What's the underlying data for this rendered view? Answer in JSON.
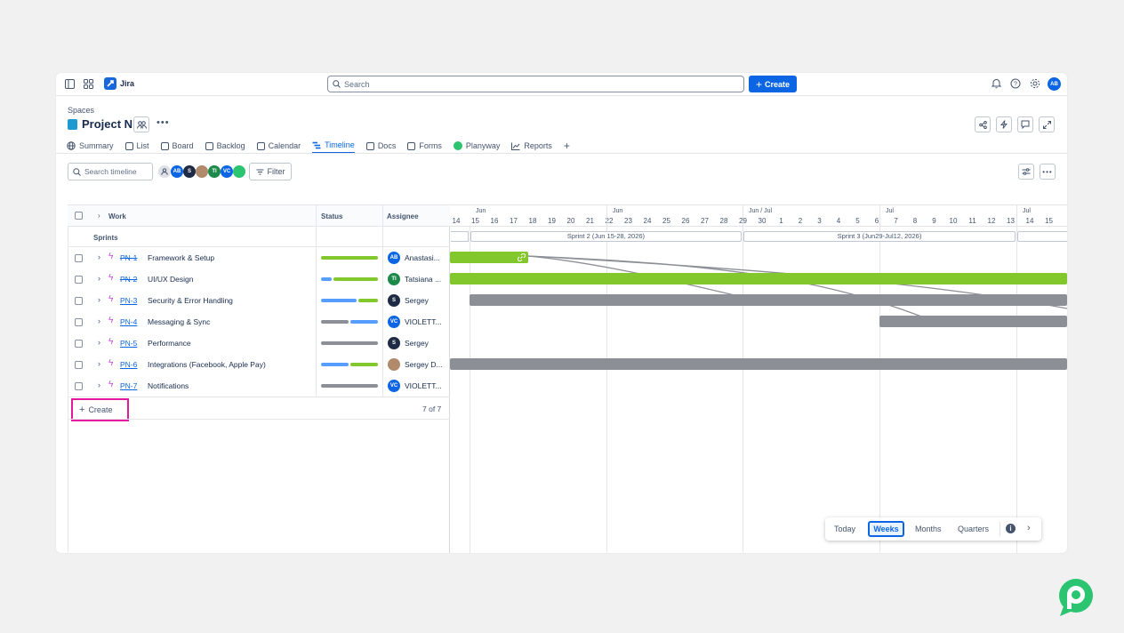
{
  "topbar": {
    "app_name": "Jira",
    "search_placeholder": "Search",
    "create_label": "Create",
    "user_initials": "AB"
  },
  "breadcrumb": "Spaces",
  "project": {
    "name": "Project N"
  },
  "tabs": [
    {
      "label": "Summary"
    },
    {
      "label": "List"
    },
    {
      "label": "Board"
    },
    {
      "label": "Backlog"
    },
    {
      "label": "Calendar"
    },
    {
      "label": "Timeline",
      "active": true
    },
    {
      "label": "Docs"
    },
    {
      "label": "Forms"
    },
    {
      "label": "Planyway"
    },
    {
      "label": "Reports"
    }
  ],
  "toolbar": {
    "search_placeholder": "Search timeline",
    "filter_label": "Filter",
    "avatars": [
      "AB",
      "S",
      "TI",
      "VC"
    ]
  },
  "table": {
    "headers": {
      "work": "Work",
      "status": "Status",
      "assignee": "Assignee"
    },
    "sprints_label": "Sprints",
    "rows": [
      {
        "key": "PN-1",
        "summary": "Framework & Setup",
        "assignee": "Anastasi...",
        "initials": "AB",
        "done": true
      },
      {
        "key": "PN-2",
        "summary": "UI/UX Design",
        "assignee": "Tatsiana ...",
        "initials": "TI",
        "done": true
      },
      {
        "key": "PN-3",
        "summary": "Security & Error Handling",
        "assignee": "Sergey",
        "initials": "S"
      },
      {
        "key": "PN-4",
        "summary": "Messaging & Sync",
        "assignee": "VIOLETT...",
        "initials": "VC"
      },
      {
        "key": "PN-5",
        "summary": "Performance",
        "assignee": "Sergey",
        "initials": "S"
      },
      {
        "key": "PN-6",
        "summary": "Integrations (Facebook, Apple Pay)",
        "assignee": "Sergey D...",
        "initials": ""
      },
      {
        "key": "PN-7",
        "summary": "Notifications",
        "assignee": "VIOLETT...",
        "initials": "VC"
      }
    ],
    "create_label": "Create",
    "count": "7 of 7"
  },
  "timeline": {
    "months": [
      "Jun",
      "Jun",
      "Jun / Jul",
      "Jul",
      "Jul"
    ],
    "days": [
      "14",
      "15",
      "16",
      "17",
      "18",
      "19",
      "20",
      "21",
      "22",
      "23",
      "24",
      "25",
      "26",
      "27",
      "28",
      "29",
      "30",
      "1",
      "2",
      "3",
      "4",
      "5",
      "6",
      "7",
      "8",
      "9",
      "10",
      "11",
      "12",
      "13",
      "14",
      "15"
    ],
    "sprints": [
      "Sprint 2 (Jun 15-28, 2026)",
      "Sprint 3 (Jun29-Jul12, 2026)"
    ]
  },
  "zoom": {
    "today": "Today",
    "weeks": "Weeks",
    "months": "Months",
    "quarters": "Quarters"
  },
  "colors": {
    "green": "#82c72b",
    "gray": "#8c8f96",
    "blue": "#0c66e4",
    "magenta": "#e5179c"
  }
}
